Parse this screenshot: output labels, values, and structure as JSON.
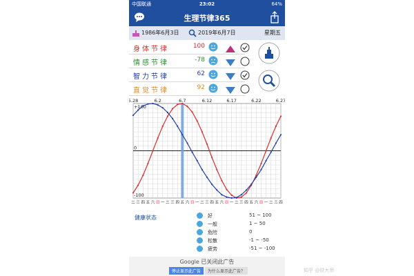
{
  "status": {
    "carrier": "中国联通",
    "time": "23:02",
    "battery": "64%"
  },
  "app": {
    "title": "生理节律365"
  },
  "dates": {
    "birth": "1986年6月3日",
    "query": "2019年6月7日",
    "weekday": "星期五"
  },
  "rows": [
    {
      "label": "身体节律",
      "value": "100",
      "color": "#d62d2d",
      "trend": "up",
      "checked": true
    },
    {
      "label": "情感节律",
      "value": "-78",
      "color": "#2e8b2e",
      "trend": "down",
      "checked": false
    },
    {
      "label": "智力节律",
      "value": "62",
      "color": "#1f3fa6",
      "trend": "down",
      "checked": true
    },
    {
      "label": "直觉节律",
      "value": "92",
      "color": "#e08a1e",
      "trend": "down",
      "checked": false
    }
  ],
  "chart_data": {
    "type": "line",
    "x_tick_labels": [
      "5.28",
      "6.2",
      "6.7",
      "6.12",
      "6.17",
      "6.22",
      "6.27"
    ],
    "y_labels": [
      "+100",
      "0",
      "-100"
    ],
    "weekday_row": [
      "二",
      "三",
      "四",
      "五",
      "六",
      "日",
      "一",
      "二",
      "三",
      "四",
      "五",
      "六",
      "日",
      "一",
      "二",
      "三",
      "四",
      "五",
      "六",
      "日",
      "一",
      "二",
      "三",
      "四",
      "五",
      "六",
      "日",
      "一",
      "二",
      "三",
      "四"
    ],
    "highlight_label": "6.7",
    "series": [
      {
        "color": "#d62d2d",
        "y": [
          -89,
          -73,
          -52,
          -27,
          0,
          27,
          52,
          73,
          89,
          98,
          100,
          94,
          82,
          63,
          40,
          14,
          -14,
          -40,
          -63,
          -82,
          -94,
          -100,
          -98,
          -89,
          -73,
          -52,
          -27,
          0,
          27,
          52,
          73
        ]
      },
      {
        "color": "#1f3fa6",
        "y": [
          75,
          86,
          95,
          99,
          100,
          97,
          91,
          81,
          68,
          52,
          34,
          16,
          -3,
          -21,
          -40,
          -56,
          -71,
          -83,
          -93,
          -98,
          -100,
          -99,
          -93,
          -83,
          -71,
          -56,
          -40,
          -21,
          -3,
          16,
          34
        ]
      }
    ]
  },
  "legend": {
    "title": "健康状态",
    "items": [
      {
        "name": "好",
        "range": "51 ~ 100"
      },
      {
        "name": "一般",
        "range": "1 ~ 50"
      },
      {
        "name": "危险",
        "range": "0"
      },
      {
        "name": "松散",
        "range": "-1 ~ -50"
      },
      {
        "name": "疲劳",
        "range": "-51 ~ -100"
      }
    ]
  },
  "ad": {
    "text": "Google 已关闭此广告",
    "stop": "停止显示此广告",
    "why": "为什么显示此广告？"
  },
  "watermark": "知乎 @财大师"
}
